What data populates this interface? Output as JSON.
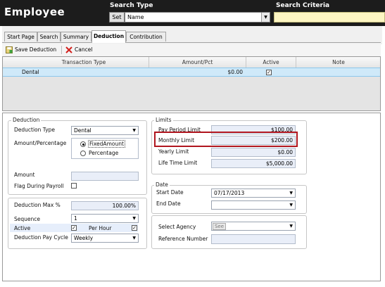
{
  "header": {
    "title": "Employee",
    "search_type_label": "Search Type",
    "search_criteria_label": "Search Criteria",
    "set_button": "Set",
    "search_type_value": "Name"
  },
  "tabs": [
    "Start Page",
    "Search",
    "Summary",
    "Deduction",
    "Contribution"
  ],
  "active_tab": "Deduction",
  "toolbar": {
    "save_label": "Save Deduction",
    "cancel_label": "Cancel"
  },
  "grid": {
    "columns": [
      "Transaction Type",
      "Amount/Pct",
      "Active",
      "Note"
    ],
    "rows": [
      {
        "type": "Dental",
        "amount": "$0.00",
        "active": true,
        "note": ""
      }
    ]
  },
  "deduction": {
    "legend": "Deduction",
    "type_label": "Deduction Type",
    "type_value": "Dental",
    "amount_pct_label": "Amount/Percentage",
    "option_fixed": "FixedAmount",
    "option_percentage": "Percentage",
    "amount_label": "Amount",
    "amount_value": "",
    "flag_label": "Flag During Payroll",
    "max_label": "Deduction Max %",
    "max_value": "100.00%",
    "sequence_label": "Sequence",
    "sequence_value": "1",
    "active_label": "Active",
    "per_hour_label": "Per Hour",
    "pay_cycle_label": "Deduction Pay Cycle",
    "pay_cycle_value": "Weekly"
  },
  "limits": {
    "legend": "Limits",
    "pay_period_label": "Pay Period Limit",
    "pay_period_value": "$100.00",
    "monthly_label": "Monthly Limit",
    "monthly_value": "$200.00",
    "yearly_label": "Yearly Limit",
    "yearly_value": "$0.00",
    "lifetime_label": "Life Time Limit",
    "lifetime_value": "$5,000.00"
  },
  "date": {
    "legend": "Date",
    "start_label": "Start Date",
    "start_value": "07/17/2013",
    "end_label": "End Date",
    "end_value": ""
  },
  "agency": {
    "select_label": "Select Agency",
    "see_button": "See",
    "reference_label": "Reference Number",
    "reference_value": ""
  },
  "colors": {
    "header_bg": "#1c1c1c",
    "criteria_bg": "#fdf6c3",
    "selected_row": "#cfe9f9",
    "highlight_box": "#b0151e"
  }
}
